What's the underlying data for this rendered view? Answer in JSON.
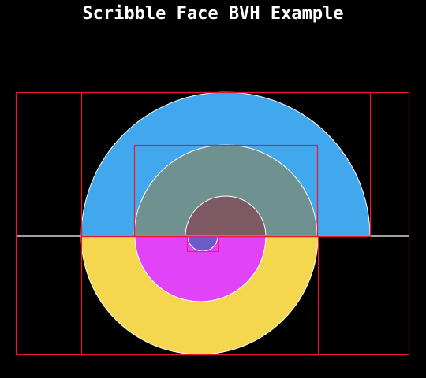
{
  "title": "Scribble Face BVH Example",
  "colors": {
    "background": "#000000",
    "title": "#ffffff",
    "outer_upper": "#42a8ee",
    "middle_upper": "#6f9190",
    "inner_upper": "#7d5a63",
    "outer_lower": "#f5d64f",
    "middle_lower": "#e043f8",
    "inner_lower": "#6b5bc8",
    "face_edge": "#ffffff",
    "axis_line": "#a0a0a0",
    "bvh_box": "#e8182f",
    "bvh_leaf_box": "#e81a8a"
  }
}
